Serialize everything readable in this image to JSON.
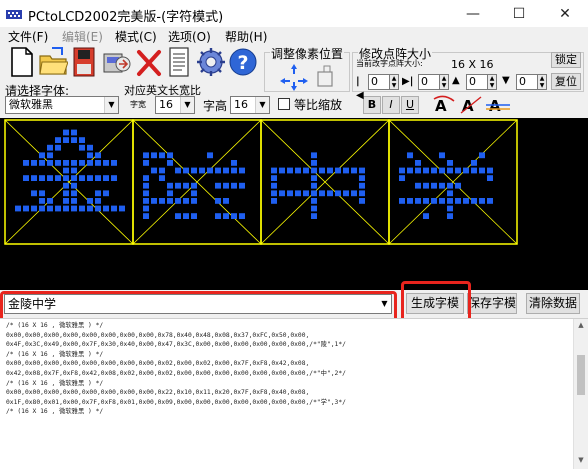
{
  "window": {
    "title": "PCtoLCD2002完美版-(字符模式)",
    "minimize_glyph": "—",
    "maximize_glyph": "☐",
    "close_glyph": "✕"
  },
  "menu": {
    "items": [
      {
        "label": "文件(F)",
        "enabled": true
      },
      {
        "label": "编辑(E)",
        "enabled": false
      },
      {
        "label": "模式(C)",
        "enabled": true
      },
      {
        "label": "选项(O)",
        "enabled": true
      },
      {
        "label": "帮助(H)",
        "enabled": true
      }
    ]
  },
  "toolbar": {
    "icons": [
      "new-icon",
      "open-icon",
      "save-icon",
      "import-icon",
      "delete-icon",
      "notes-icon",
      "settings-gear-icon",
      "help-icon"
    ],
    "font_label": "请选择字体:",
    "font_value": "微软雅黑",
    "width_label": "对应英文长宽比",
    "char_width_label": "字宽",
    "char_width_value": "16",
    "char_height_label": "字高",
    "char_height_value": "16",
    "proportional_label": "等比缩放",
    "bold_label": "B",
    "italic_label": "I",
    "underline_label": "U",
    "adjust_title": "调整像素位置",
    "resize_title": "修改点阵大小",
    "current_size_label": "当前改字点阵大小:",
    "size_text": "16 X 16",
    "lock_label": "锁定",
    "restore_label": "复位",
    "spin1_value": "0",
    "spin2_value": "0",
    "spin3_value": "0",
    "spin4_value": "0"
  },
  "preview": {
    "grid_color": "#ffff00",
    "pixel_color": "#1f5ff0",
    "background": "#000000",
    "cells": 4
  },
  "input": {
    "text": "金陵中学",
    "generate_label": "生成字模",
    "save_label": "保存字模",
    "clear_label": "清除数据"
  },
  "output": {
    "lines": [
      "/* (16 X 16 , 微软雅黑 ) */",
      "",
      "0x00,0x00,0x00,0x00,0x00,0x00,0x00,0x00,0x78,0x40,0x48,0x08,0x37,0xFC,0x50,0x00,",
      "0x4F,0x3C,0x49,0x00,0x7F,0x30,0x40,0x00,0x47,0x3C,0x00,0x00,0x00,0x00,0x00,0x00,/*\"陵\",1*/",
      "/* (16 X 16 , 微软雅黑 ) */",
      "",
      "0x00,0x00,0x00,0x00,0x00,0x00,0x00,0x00,0x02,0x00,0x02,0x00,0x7F,0xF8,0x42,0x08,",
      "0x42,0x08,0x7F,0xF8,0x42,0x08,0x02,0x00,0x02,0x00,0x00,0x00,0x00,0x00,0x00,0x00,/*\"中\",2*/",
      "/* (16 X 16 , 微软雅黑 ) */",
      "",
      "0x00,0x00,0x00,0x00,0x00,0x00,0x00,0x00,0x22,0x10,0x11,0x20,0x7F,0xF8,0x40,0x08,",
      "0x1F,0x80,0x01,0x00,0x7F,0xF8,0x01,0x00,0x09,0x00,0x00,0x00,0x00,0x00,0x00,0x00,/*\"学\",3*/",
      "/* (16 X 16 , 微软雅黑 ) */"
    ]
  }
}
